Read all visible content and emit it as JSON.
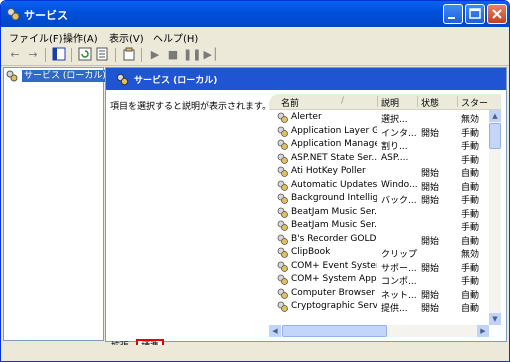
{
  "window": {
    "title": "サービス",
    "controls": [
      "minimize",
      "maximize",
      "close"
    ]
  },
  "menu": [
    "ファイル(F)",
    "操作(A)",
    "表示(V)",
    "ヘルプ(H)"
  ],
  "toolbar_icons": [
    "back-arrow-icon",
    "forward-arrow-icon",
    "show-hide-tree-icon",
    "refresh-icon",
    "export-list-icon",
    "properties-icon",
    "start-icon",
    "stop-icon",
    "pause-icon",
    "restart-icon"
  ],
  "tree": {
    "root_label": "サービス (ローカル)"
  },
  "pane": {
    "title": "サービス (ローカル)",
    "description": "項目を選択すると説明が表示されます。"
  },
  "list": {
    "columns": [
      "名前",
      "説明",
      "状態",
      "スター"
    ],
    "sort_indicator": "/",
    "rows": [
      [
        "Alerter",
        "選択...",
        "",
        "無効"
      ],
      [
        "Application Layer G...",
        "インタ...",
        "開始",
        "手動"
      ],
      [
        "Application Manage...",
        "割り...",
        "",
        "手動"
      ],
      [
        "ASP.NET State Ser...",
        "ASP....",
        "",
        "手動"
      ],
      [
        "Ati HotKey Poller",
        "",
        "開始",
        "自動"
      ],
      [
        "Automatic Updates",
        "Windo...",
        "開始",
        "自動"
      ],
      [
        "Background Intellig...",
        "バック...",
        "開始",
        "手動"
      ],
      [
        "BeatJam Music Ser...",
        "",
        "",
        "手動"
      ],
      [
        "BeatJam Music Ser...",
        "",
        "",
        "手動"
      ],
      [
        "B's Recorder GOLD...",
        "",
        "開始",
        "自動"
      ],
      [
        "ClipBook",
        "クリップ...",
        "",
        "無効"
      ],
      [
        "COM+ Event System",
        "サポー...",
        "開始",
        "手動"
      ],
      [
        "COM+ System Appl...",
        "コンポ...",
        "",
        "手動"
      ],
      [
        "Computer Browser",
        "ネット...",
        "開始",
        "自動"
      ],
      [
        "Cryptographic Servi...",
        "提供...",
        "開始",
        "自動"
      ]
    ]
  },
  "tabs": [
    "拡張",
    "標準"
  ],
  "colors": {
    "titlebar": "#0151dc",
    "selection": "#316ac5",
    "highlight_box": "#e00000"
  }
}
